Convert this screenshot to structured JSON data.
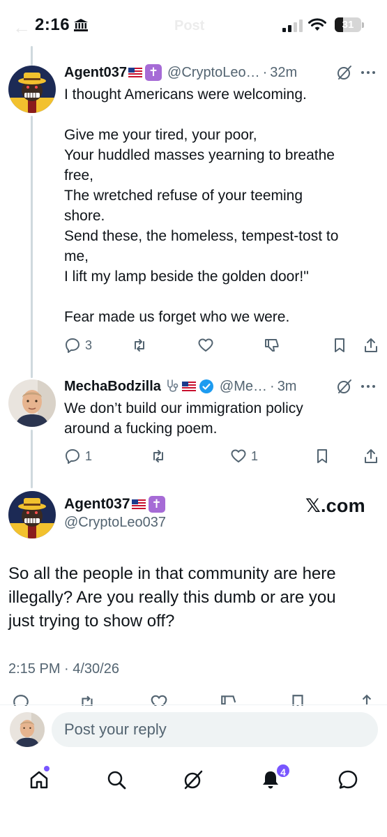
{
  "status_bar": {
    "time": "2:16",
    "ghost_title": "Post",
    "battery": "31",
    "battery_level": 0.31
  },
  "tweets": [
    {
      "display_name": "Agent037",
      "cross_badge": "✝",
      "handle": "@CryptoLeo…",
      "separator": "·",
      "time_ago": "32m",
      "text_lines": [
        "I thought Americans were welcoming.",
        "",
        "Give me your tired, your poor,",
        "Your huddled masses yearning to breathe",
        "free,",
        "The wretched refuse of your teeming",
        "shore.",
        "Send these, the homeless, tempest-tost to",
        "me,",
        "I lift my lamp beside the golden door!\"",
        "",
        "Fear made us forget who we were."
      ],
      "replies": "3",
      "reposts": "",
      "likes": ""
    },
    {
      "display_name": "MechaBodzilla",
      "handle": "@Me…",
      "separator": "·",
      "time_ago": "3m",
      "text_lines": [
        "We don’t build our immigration policy",
        "around a fucking poem."
      ],
      "replies": "1",
      "reposts": "",
      "likes": "1"
    }
  ],
  "main_post": {
    "display_name": "Agent037",
    "cross_badge": "✝",
    "handle": "@CryptoLeo037",
    "watermark": "𝕏.com",
    "text_lines": [
      "So all the people in that community are here",
      "illegally? Are you really this dumb or are you",
      "just trying to show off?"
    ],
    "timestamp": "2:15 PM · 4/30/26"
  },
  "reply_composer": {
    "placeholder": "Post your reply"
  },
  "nav": {
    "notifications_badge": "4"
  },
  "colors": {
    "text": "#0f1419",
    "secondary": "#536471",
    "accent_purple": "#7856ff",
    "verified_blue": "#1d9bf0",
    "thread_line": "#cfd9de"
  }
}
